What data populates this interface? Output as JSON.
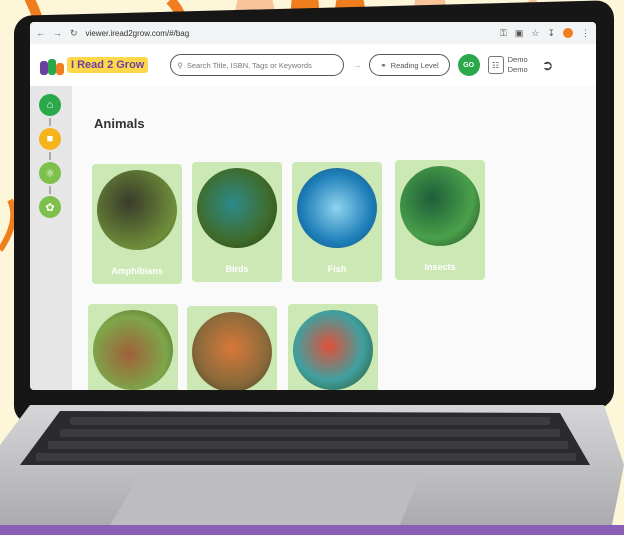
{
  "browser": {
    "url": "viewer.iread2grow.com/#/bag"
  },
  "app": {
    "brand_name": "I Read 2 Grow",
    "search_placeholder": "Search Title, ISBN, Tags or Keywords",
    "reading_level_label": "Reading Level",
    "go_label": "GO",
    "user_first": "Demo",
    "user_last": "Demo"
  },
  "sidebar": {
    "icons": [
      "home-icon",
      "graduation-cap-icon",
      "microscope-icon",
      "paw-icon"
    ]
  },
  "page": {
    "title": "Animals"
  },
  "categories": [
    "Amphibians",
    "Birds",
    "Fish",
    "Insects",
    "",
    "",
    ""
  ],
  "colors": {
    "accent_green": "#2aa84a",
    "card_green": "#cce8b5",
    "brand_yellow": "#ffd84a",
    "swirl_orange": "#f07d1e"
  }
}
